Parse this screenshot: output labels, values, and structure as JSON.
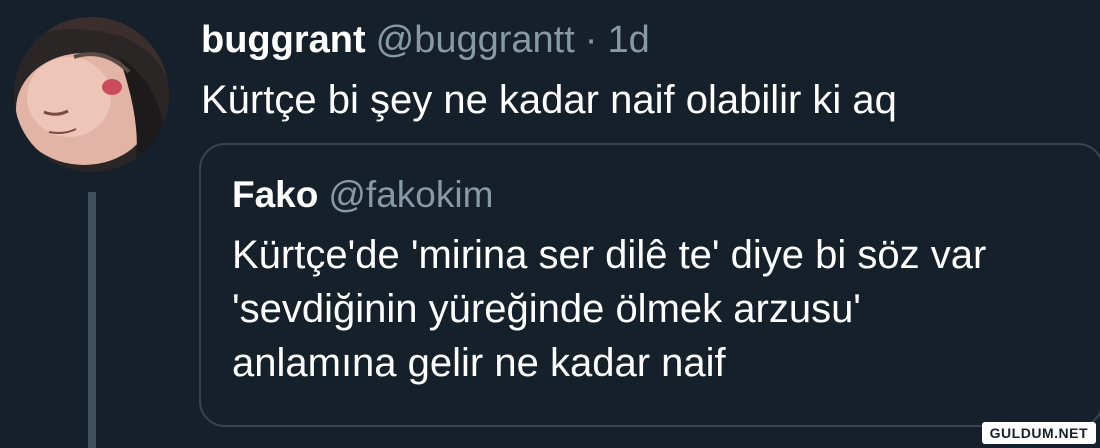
{
  "colors": {
    "background": "#15202b",
    "text_primary": "#ffffff",
    "text_secondary": "#8899a6",
    "border": "#38444d",
    "thread_line": "#40505f"
  },
  "tweet": {
    "author_name": "buggrant",
    "author_handle": "@buggrantt",
    "separator": "·",
    "time": "1d",
    "text": "Kürtçe bi şey ne kadar naif olabilir ki aq",
    "avatar_icon": "profile-photo"
  },
  "quoted_tweet": {
    "author_name": "Fako",
    "author_handle": "@fakokim",
    "lines": [
      "Kürtçe'de 'mirina ser dilê te' diye bi söz var",
      "'sevdiğinin yüreğinde ölmek arzusu'",
      "anlamına gelir ne kadar naif"
    ]
  },
  "watermark": "GULDUM.NET"
}
